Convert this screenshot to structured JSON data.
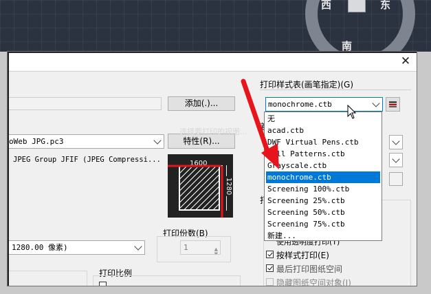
{
  "viewcube": {
    "north": "南",
    "west": "西",
    "east": "东"
  },
  "dialog": {
    "close_glyph": "✕",
    "add_button": "添加(.)...",
    "properties_button": "特性(R)...",
    "plotter_value": "oWeb JPG.pc3",
    "plotter_description": "JPEG Group JFIF (JPEG Compressi...",
    "paper_size_value": "1280.00 像素)",
    "copies_label": "打印份数(B)",
    "copies_value": "1",
    "plot_scale_label": "打印比例",
    "preview": {
      "width_label": "1600",
      "height_label": "1280"
    },
    "faded_text": "着色视口选项",
    "faded_hint": "选择要打印的视图..."
  },
  "plot_style": {
    "label": "打印样式表(画笔指定)(G)",
    "selected": "monochrome.ctb",
    "edit_icon": "edit-plot-style-icon",
    "options": [
      "无",
      "acad.ctb",
      "DWF Virtual Pens.ctb",
      "Fill Patterns.ctb",
      "Grayscale.ctb",
      "monochrome.ctb",
      "Screening 100%.ctb",
      "Screening 25%.ctb",
      "Screening 50%.ctb",
      "Screening 75%.ctb",
      "新建..."
    ],
    "highlighted_index": 5
  },
  "plot_options": {
    "partial_header": "打",
    "hidden_option": "使用透明度打印(T)",
    "print_with_styles": "按样式打印(E)",
    "print_with_styles_checked": true,
    "last_paperspace": "最后打印图纸空间",
    "hide_paperspace": "隐藏图纸空间对象(J)"
  },
  "annotation": {
    "arrow_color": "#e8141c"
  }
}
